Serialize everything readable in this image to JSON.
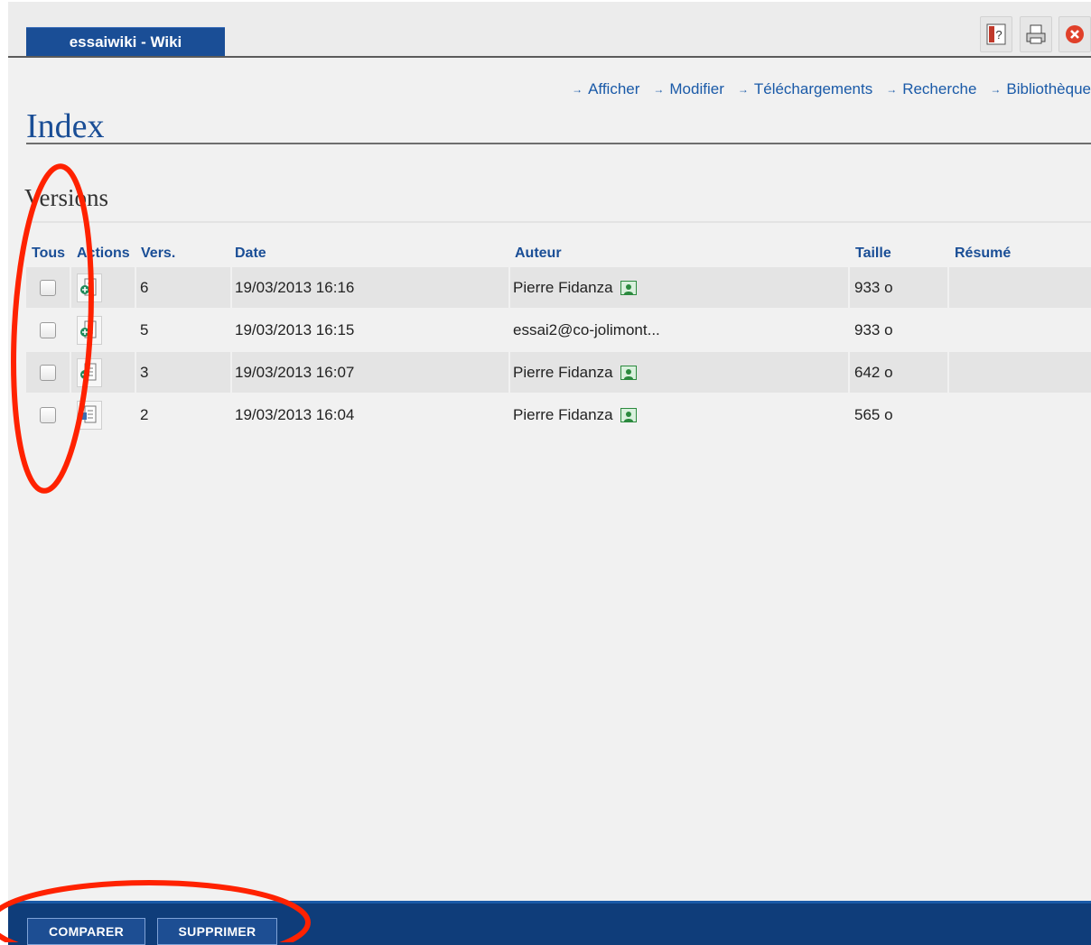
{
  "portlet": {
    "title": "essaiwiki - Wiki"
  },
  "toolbar": {
    "icons": [
      "help-icon",
      "print-icon",
      "close-icon"
    ]
  },
  "nav": [
    {
      "label": "Afficher"
    },
    {
      "label": "Modifier"
    },
    {
      "label": "Téléchargements"
    },
    {
      "label": "Recherche"
    },
    {
      "label": "Bibliothèque"
    }
  ],
  "page": {
    "title": "Index",
    "section": "Versions"
  },
  "table": {
    "headers": {
      "all": "Tous",
      "actions": "Actions",
      "version": "Vers.",
      "date": "Date",
      "author": "Auteur",
      "size": "Taille",
      "summary": "Résumé"
    },
    "rows": [
      {
        "version": "6",
        "date": "19/03/2013 16:16",
        "author": "Pierre Fidanza",
        "author_icon": true,
        "size": "933 o",
        "summary": ""
      },
      {
        "version": "5",
        "date": "19/03/2013 16:15",
        "author": "essai2@co-jolimont...",
        "author_icon": false,
        "size": "933 o",
        "summary": ""
      },
      {
        "version": "3",
        "date": "19/03/2013 16:07",
        "author": "Pierre Fidanza",
        "author_icon": true,
        "size": "642 o",
        "summary": ""
      },
      {
        "version": "2",
        "date": "19/03/2013 16:04",
        "author": "Pierre Fidanza",
        "author_icon": true,
        "size": "565 o",
        "summary": ""
      }
    ]
  },
  "buttons": {
    "compare": "COMPARER",
    "delete": "SUPPRIMER"
  },
  "colors": {
    "accent": "#1a4e96",
    "bar": "#0f3d7a",
    "annotation": "#ff2200"
  }
}
